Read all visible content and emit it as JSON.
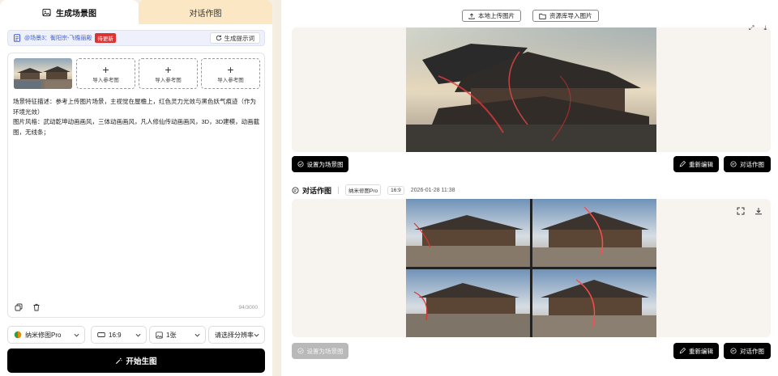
{
  "left": {
    "tabs": [
      {
        "label": "生成场景图",
        "active": true
      },
      {
        "label": "对话作图",
        "active": false
      }
    ],
    "scene": {
      "label": "@场景3：衡阳宗-飞檐丽殿",
      "badge": "待更新",
      "gen_prompt_label": "生成提示词"
    },
    "refs": {
      "add_label": "导入参考图"
    },
    "prompt": {
      "line1": "场景特征描述：参考上传图片场景，主视觉在屋檐上，红色灵力光效与黑色妖气痕迹（作为环境光效）",
      "line2": "图片风格：武动乾坤动画画风，三体动画画风，凡人修仙传动画画风，3D，3D建模，动画截图，无线条；",
      "count": "94/3000"
    },
    "options": {
      "model": "纳米修图Pro",
      "ratio": "16:9",
      "count": "1张",
      "resolution": "请选择分辨率"
    },
    "start_label": "开始生图"
  },
  "right": {
    "upload_local": "本地上传图片",
    "import_library": "资源库导入图片",
    "card1": {
      "set_scene": "设置为场景图",
      "re_edit": "重新编辑",
      "dialog_draw": "对话作图"
    },
    "meta": {
      "title": "对话作图",
      "model": "纳米修图Pro",
      "ratio": "16:9",
      "time": "2026-01-28 11:38"
    },
    "card2": {
      "set_scene": "设置为场景图",
      "re_edit": "重新编辑",
      "dialog_draw": "对话作图"
    }
  },
  "colors": {
    "accent_blue": "#3b5bdb",
    "badge_red": "#e03131",
    "primary_black": "#000000",
    "tab_inactive": "#fbe7c4"
  }
}
